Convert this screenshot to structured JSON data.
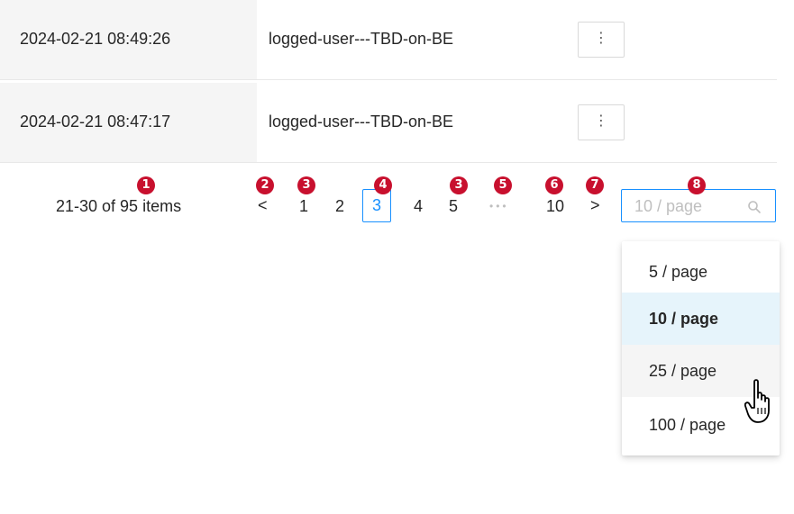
{
  "rows": [
    {
      "date": "2024-02-21 08:49:26",
      "user": "logged-user---TBD-on-BE",
      "menu": "⋮"
    },
    {
      "date": "2024-02-21 08:47:17",
      "user": "logged-user---TBD-on-BE",
      "menu": "⋮"
    }
  ],
  "pagination": {
    "total_text": "21-30 of 95 items",
    "prev": "<",
    "next": ">",
    "pages": [
      "1",
      "2",
      "3",
      "4",
      "5",
      "10"
    ],
    "active_page": "3",
    "ellipsis": "•••",
    "size_placeholder": "10 / page"
  },
  "badges": [
    "1",
    "2",
    "3",
    "4",
    "3",
    "5",
    "6",
    "7",
    "8"
  ],
  "dropdown": {
    "options": [
      "5 / page",
      "10 / page",
      "25 / page",
      "100 / page"
    ],
    "selected": "10 / page",
    "hovered": "25 / page"
  },
  "colors": {
    "accent": "#1890ff",
    "badge": "#c8102e",
    "selected_bg": "#e6f4fb",
    "hover_bg": "#f5f5f5"
  },
  "icons": [
    "more-vertical-icon",
    "search-icon",
    "hand-pointer-cursor-icon",
    "chevron-left-icon",
    "chevron-right-icon"
  ]
}
